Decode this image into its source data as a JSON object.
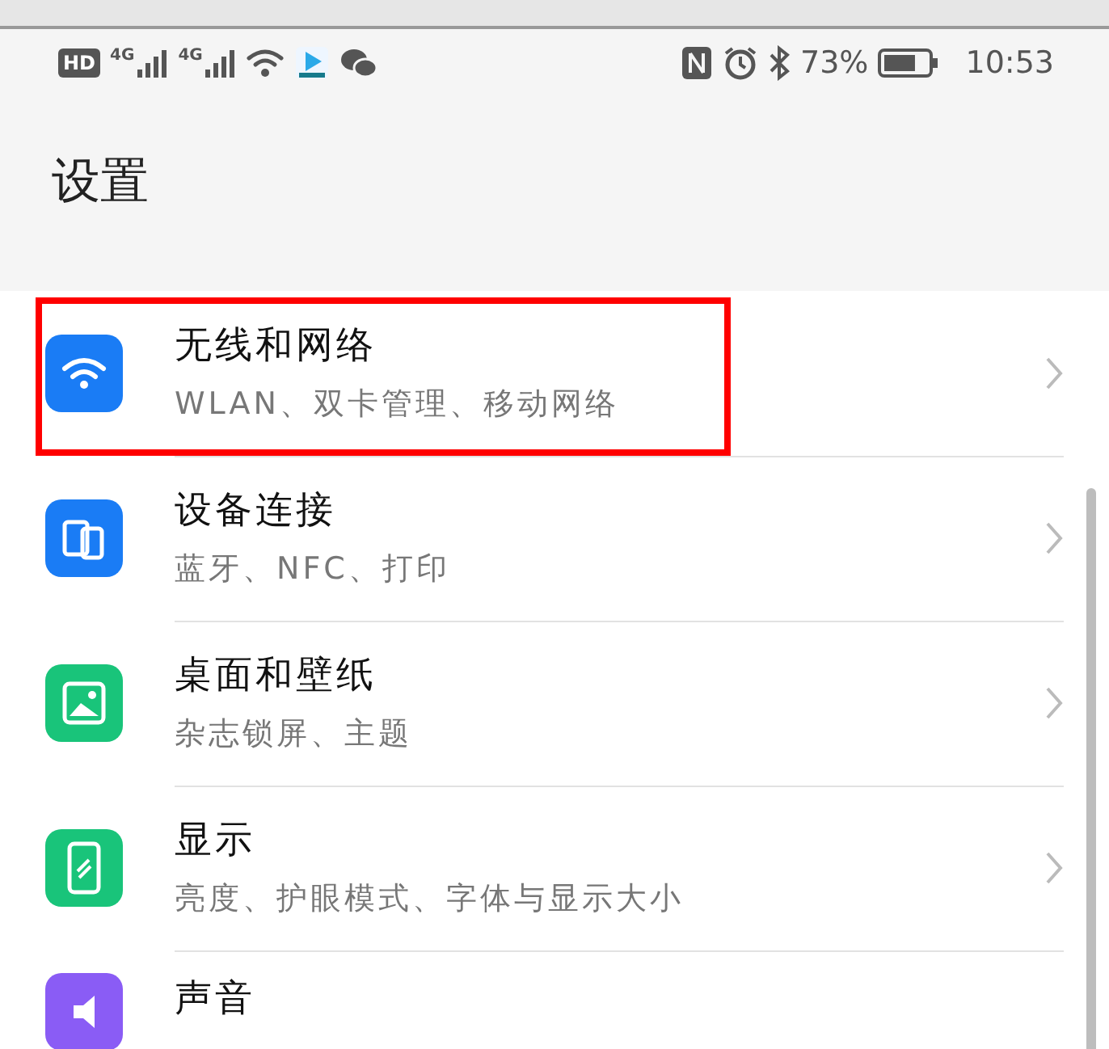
{
  "status_bar": {
    "badge": "HD",
    "networks": [
      "4G",
      "4G"
    ],
    "battery_percent": "73%",
    "battery": {
      "level": 0.73
    },
    "time": "10:53"
  },
  "title": "设置",
  "items": [
    {
      "kind": "wifi",
      "title": "无线和网络",
      "subtitle": "WLAN、双卡管理、移动网络",
      "color": "#1a7cf5",
      "highlighted": true
    },
    {
      "kind": "devices",
      "title": "设备连接",
      "subtitle": "蓝牙、NFC、打印",
      "color": "#1a7cf5",
      "highlighted": false
    },
    {
      "kind": "wallpaper",
      "title": "桌面和壁纸",
      "subtitle": "杂志锁屏、主题",
      "color": "#19c47a",
      "highlighted": false
    },
    {
      "kind": "display",
      "title": "显示",
      "subtitle": "亮度、护眼模式、字体与显示大小",
      "color": "#19c47a",
      "highlighted": false
    },
    {
      "kind": "sound",
      "title": "声音",
      "color": "#8a5cf5",
      "highlighted": false
    }
  ]
}
